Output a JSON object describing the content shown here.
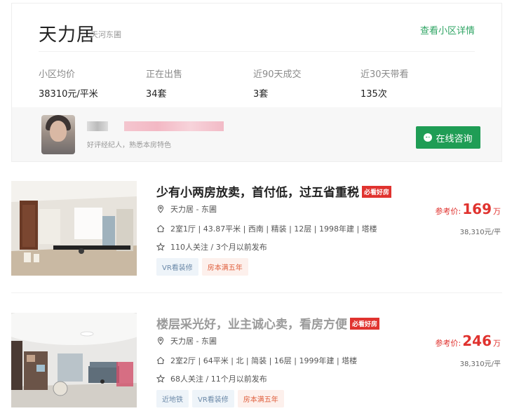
{
  "community": {
    "name": "天力居",
    "district": "天河东圃",
    "detail_link": "查看小区详情",
    "stats": [
      {
        "label": "小区均价",
        "value": "38310元/平米"
      },
      {
        "label": "正在出售",
        "value": "34套"
      },
      {
        "label": "近90天成交",
        "value": "3套"
      },
      {
        "label": "近30天带看",
        "value": "135次"
      }
    ]
  },
  "agent": {
    "description": "好评经纪人，熟悉本房特色",
    "consult_label": "在线咨询"
  },
  "listings": [
    {
      "title": "少有小两房放卖，首付低，过五省重税",
      "badge": "必看好房",
      "location": "天力居 - 东圃",
      "info": "2室1厅 | 43.87平米 | 西南 | 精装 | 12层 | 1998年建 | 塔楼",
      "follow": "110人关注 / 3个月以前发布",
      "tags": [
        "VR看装修",
        "房本满五年"
      ],
      "price_label": "参考价:",
      "price": "169",
      "price_unit": "万",
      "unit_price": "38,310元/平"
    },
    {
      "title": "楼层采光好，业主诚心卖，看房方便",
      "badge": "必看好房",
      "location": "天力居 - 东圃",
      "info": "2室2厅 | 64平米 | 北 | 简装 | 16层 | 1999年建 | 塔楼",
      "follow": "68人关注 / 11个月以前发布",
      "tags": [
        "近地铁",
        "VR看装修",
        "房本满五年"
      ],
      "price_label": "参考价:",
      "price": "246",
      "price_unit": "万",
      "unit_price": "38,310元/平"
    }
  ],
  "icons": {
    "location": "location-pin-icon",
    "house": "house-icon",
    "star": "star-icon",
    "chat": "chat-bubble-icon"
  },
  "colors": {
    "accent_green": "#1f9d55",
    "price_red": "#e0332f",
    "tag_blue_text": "#6b89a8",
    "tag_red_text": "#e0613f"
  }
}
